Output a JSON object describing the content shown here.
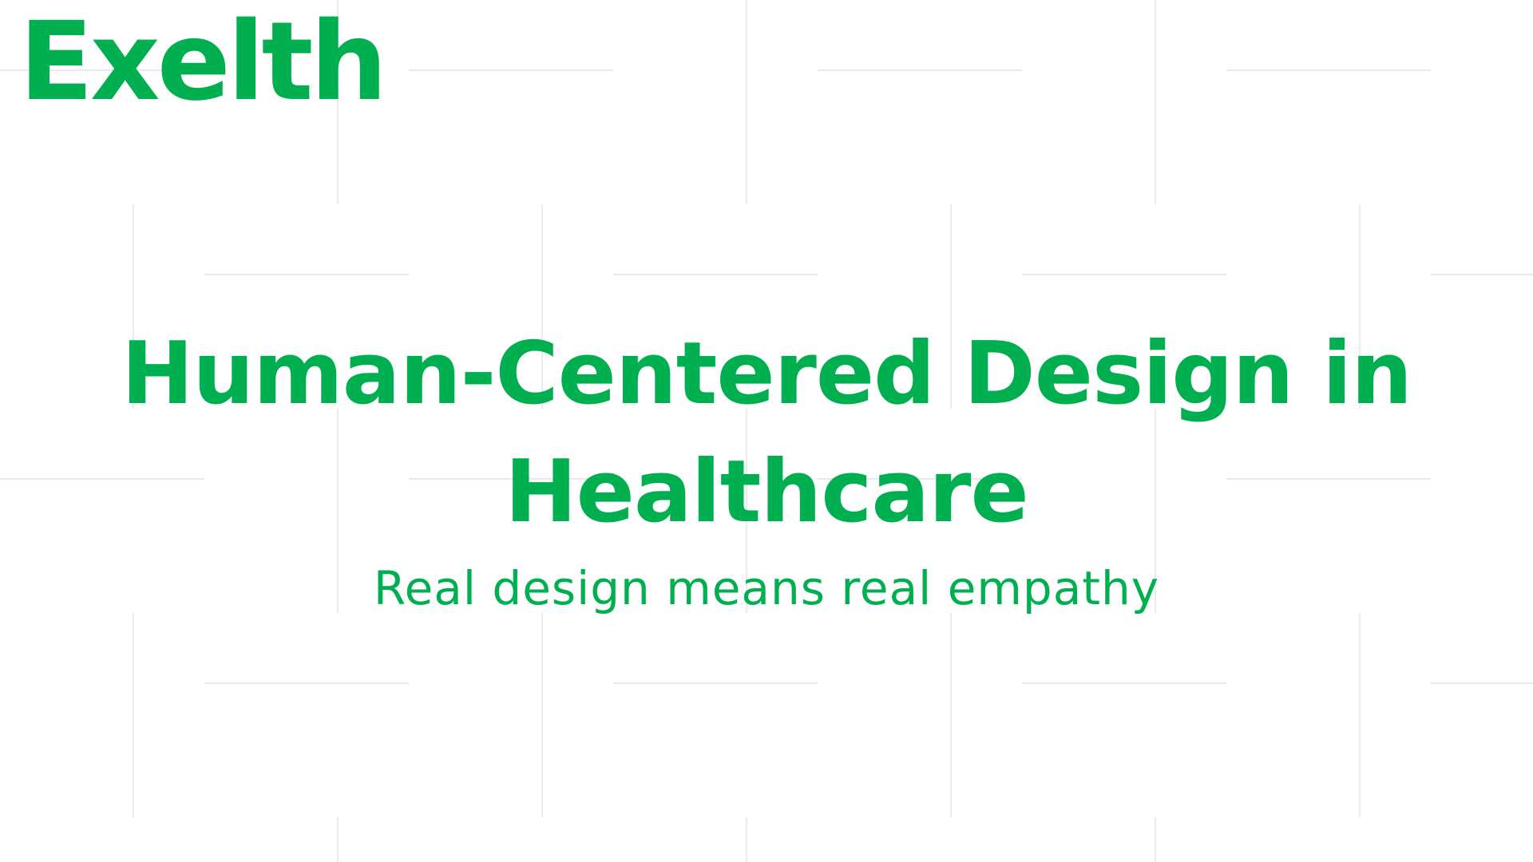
{
  "brand": {
    "name": "Exelth"
  },
  "hero": {
    "headline_line1": "Human-Centered Design in",
    "headline_line2": "Healthcare",
    "subtitle": "Real design means real empathy"
  },
  "theme": {
    "accent_color": "#00b050",
    "background_color": "#ffffff",
    "grid_line_color": "#d6d6d6"
  }
}
